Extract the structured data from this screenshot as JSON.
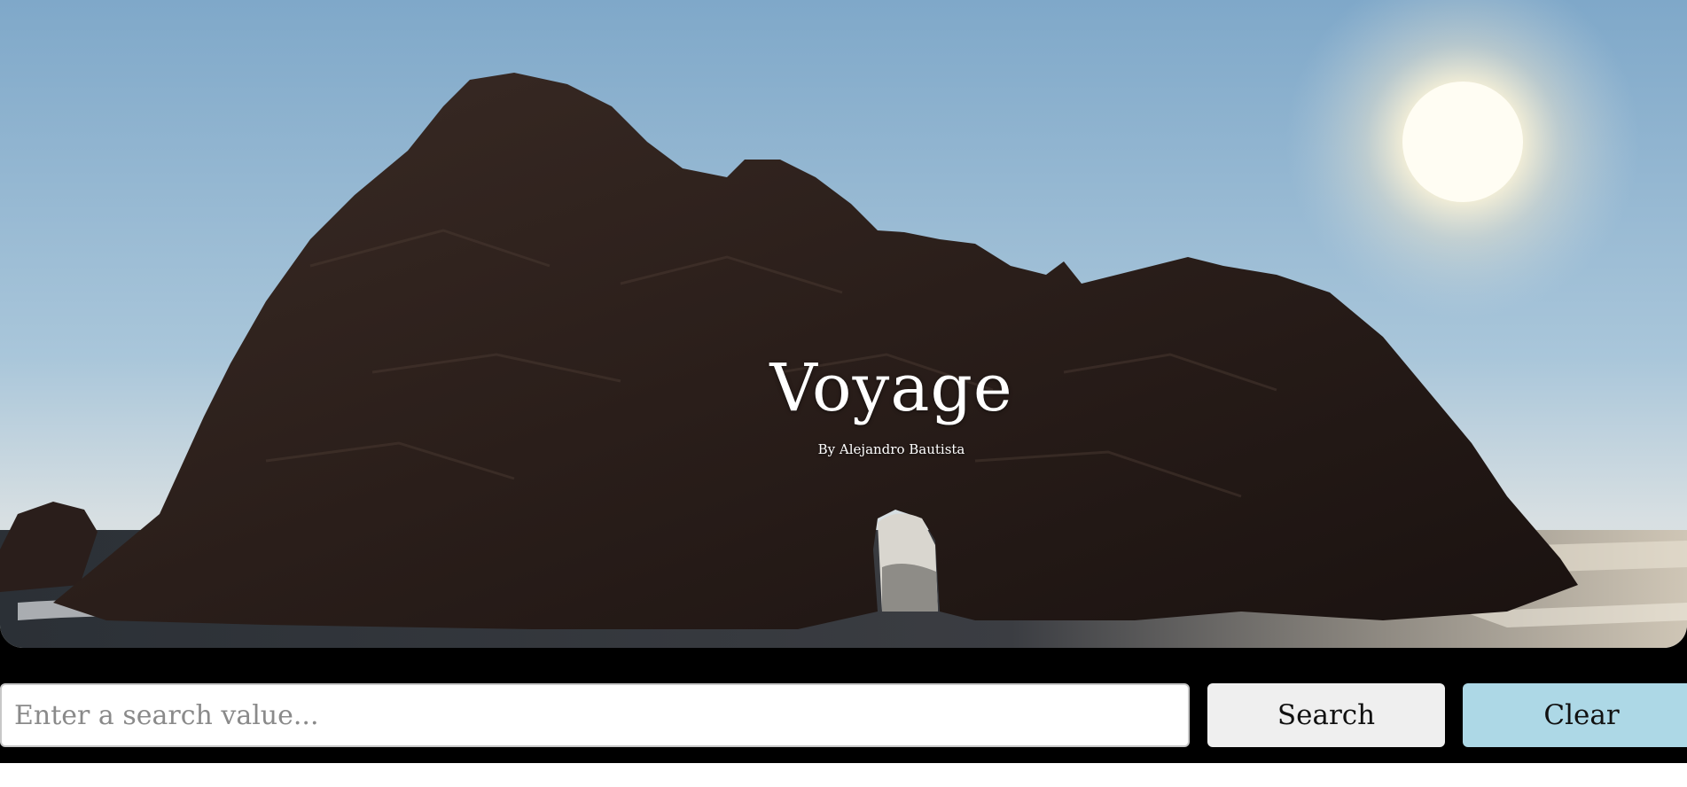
{
  "hero": {
    "title": "Voyage",
    "byline": "By Alejandro Bautista",
    "image_subject": "sea-arch-rock-at-sunset"
  },
  "search": {
    "placeholder": "Enter a search value...",
    "value": "",
    "search_label": "Search",
    "clear_label": "Clear"
  },
  "colors": {
    "clear_button": "#add8e6",
    "search_button": "#efefef",
    "bar_background": "#000000"
  }
}
